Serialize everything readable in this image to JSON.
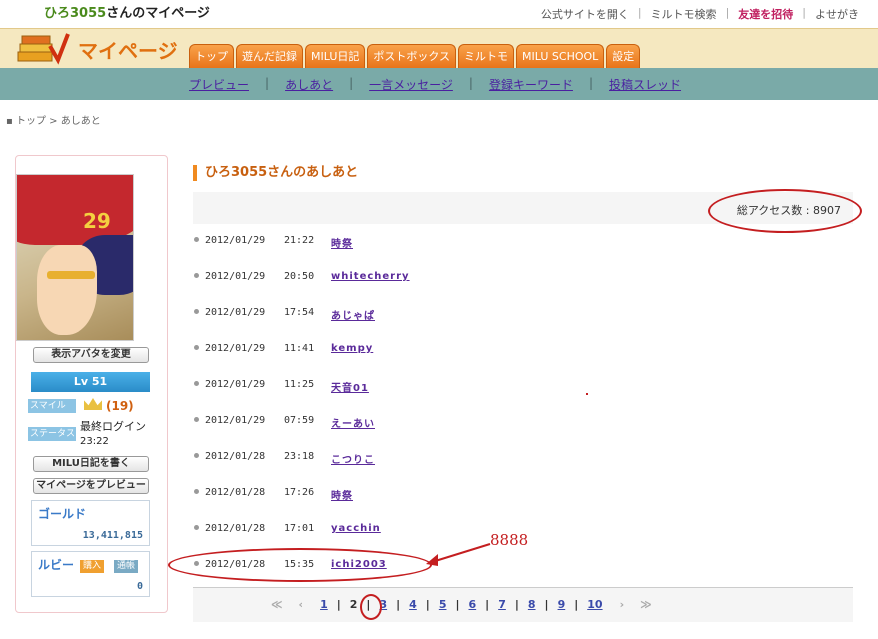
{
  "header": {
    "user_name": "ひろ3055",
    "title_suffix": "さんのマイページ",
    "logo_text": "マイページ"
  },
  "toplinks": {
    "official": "公式サイトを開く",
    "search": "ミルトモ検索",
    "invite": "友達を招待",
    "guestbook": "よせがき"
  },
  "tabs": [
    "トップ",
    "遊んだ記録",
    "MILU日記",
    "ポストボックス",
    "ミルトモ",
    "MILU SCHOOL",
    "設定"
  ],
  "subnav": [
    "プレビュー",
    "あしあと",
    "一言メッセージ",
    "登録キーワード",
    "投稿スレッド"
  ],
  "breadcrumb": "トップ > あしあと",
  "sidebar": {
    "change_avatar": "表示アバタを変更",
    "level": "Lv 51",
    "smile_tag": "スマイル",
    "smile_count": "(19)",
    "status_tag": "ステータス",
    "last_login_label": "最終ログイン",
    "last_login_time": "23:22",
    "write_diary": "MILU日記を書く",
    "preview_page": "マイページをプレビュー",
    "gold_label": "ゴールド",
    "gold_value": "13,411,815",
    "ruby_label": "ルビー",
    "ruby_buy": "購入",
    "ruby_history": "通帳",
    "ruby_value": "0",
    "avatar_number": "29"
  },
  "main": {
    "section_title": "ひろ3055さんのあしあと",
    "access_label": "総アクセス数 : 8907"
  },
  "footprints": [
    {
      "date": "2012/01/29",
      "time": "21:22",
      "visitor": "時祭"
    },
    {
      "date": "2012/01/29",
      "time": "20:50",
      "visitor": "whitecherry"
    },
    {
      "date": "2012/01/29",
      "time": "17:54",
      "visitor": "あじゃぱ"
    },
    {
      "date": "2012/01/29",
      "time": "11:41",
      "visitor": "kempy"
    },
    {
      "date": "2012/01/29",
      "time": "11:25",
      "visitor": "天音01"
    },
    {
      "date": "2012/01/29",
      "time": "07:59",
      "visitor": "えーあい"
    },
    {
      "date": "2012/01/28",
      "time": "23:18",
      "visitor": "こつりこ"
    },
    {
      "date": "2012/01/28",
      "time": "17:26",
      "visitor": "時祭"
    },
    {
      "date": "2012/01/28",
      "time": "17:01",
      "visitor": "yacchin"
    },
    {
      "date": "2012/01/28",
      "time": "15:35",
      "visitor": "ichi2003"
    }
  ],
  "pager": {
    "first": "≪",
    "prev": "≪",
    "pages": [
      "1",
      "2",
      "3",
      "4",
      "5",
      "6",
      "7",
      "8",
      "9",
      "10"
    ],
    "current": "2",
    "next": "≫",
    "last": "≫"
  },
  "annotation": {
    "note": "8888",
    "color": "#c41e20"
  }
}
